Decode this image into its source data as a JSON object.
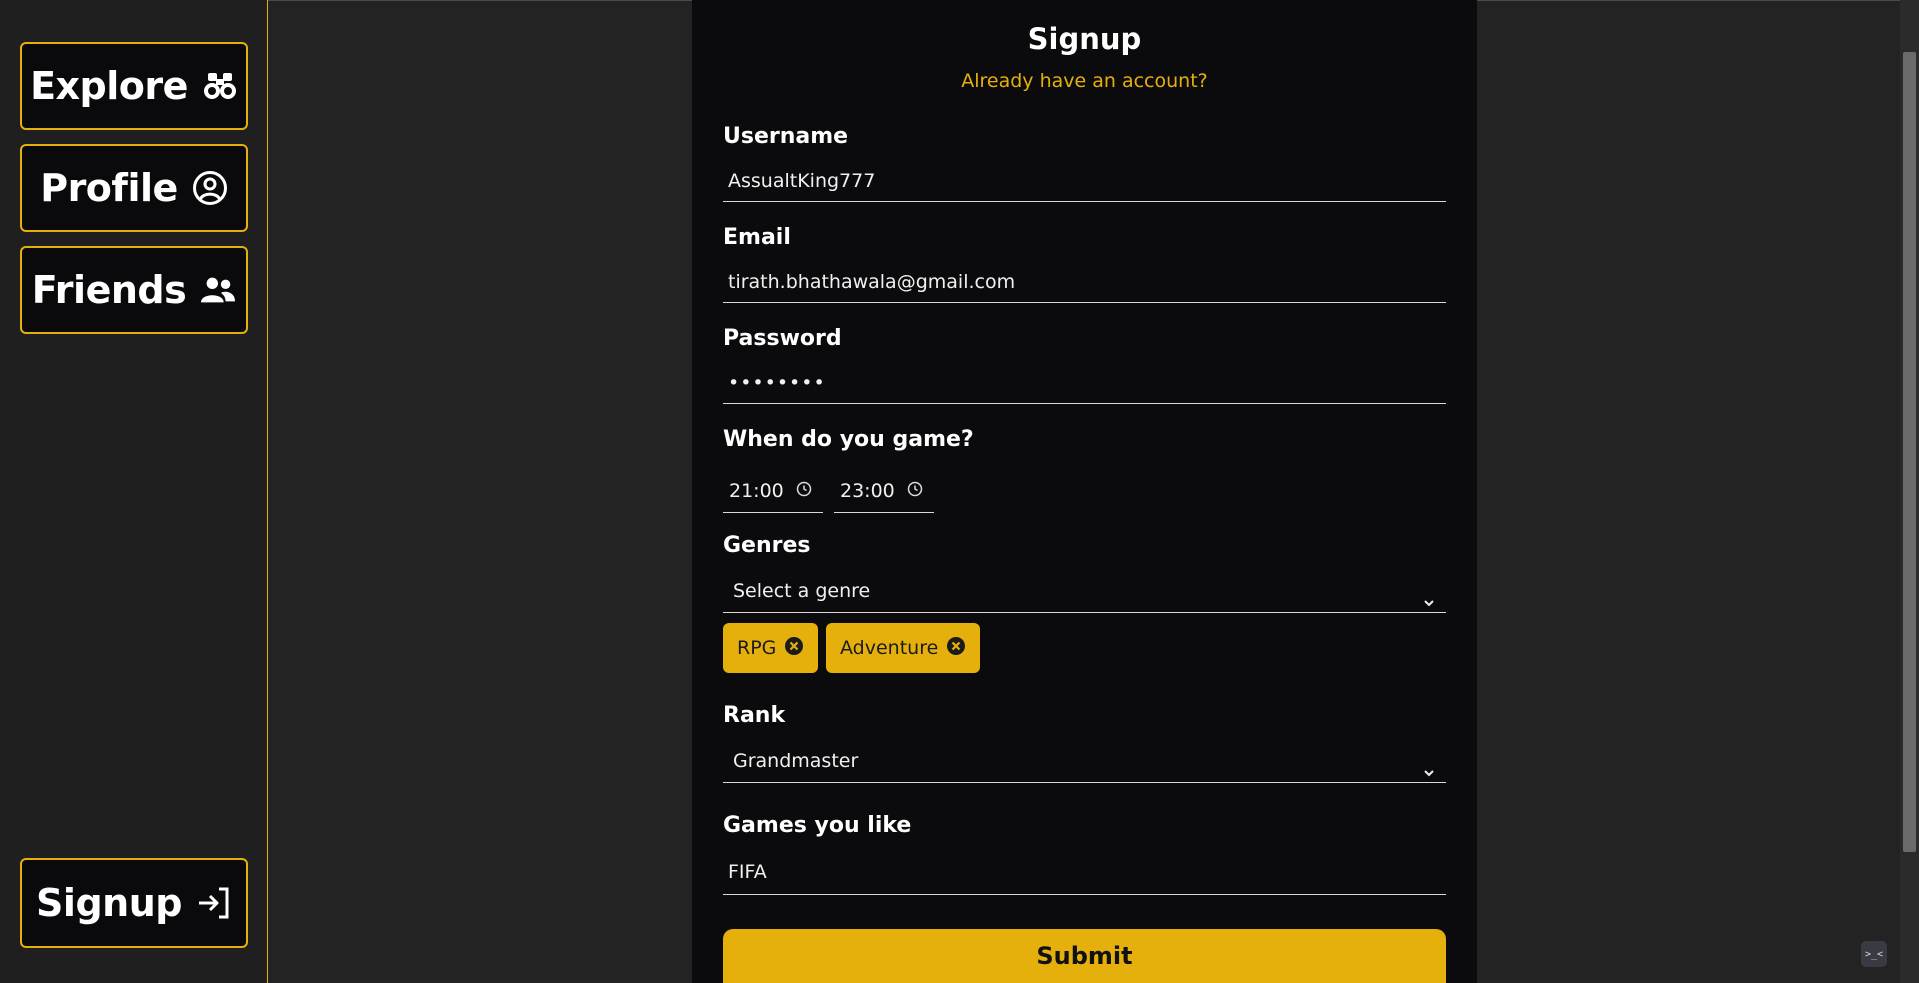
{
  "sidebar": {
    "items": [
      {
        "label": "Explore",
        "icon": "binoculars-icon"
      },
      {
        "label": "Profile",
        "icon": "user-circle-icon"
      },
      {
        "label": "Friends",
        "icon": "users-icon"
      }
    ],
    "signup": {
      "label": "Signup",
      "icon": "sign-in-icon"
    }
  },
  "form": {
    "title": "Signup",
    "subtitle": "Already have an account?",
    "username": {
      "label": "Username",
      "value": "AssualtKing777"
    },
    "email": {
      "label": "Email",
      "value": "tirath.bhathawala@gmail.com"
    },
    "password": {
      "label": "Password",
      "value": "••••••••"
    },
    "schedule": {
      "label": "When do you game?",
      "start": "21:00",
      "end": "23:00"
    },
    "genres": {
      "label": "Genres",
      "placeholder": "Select a genre",
      "selected": [
        "RPG",
        "Adventure"
      ]
    },
    "rank": {
      "label": "Rank",
      "value": "Grandmaster"
    },
    "games": {
      "label": "Games you like",
      "value": "FIFA"
    },
    "submit_label": "Submit"
  },
  "colors": {
    "accent": "#e6b00c",
    "panel": "#0b0b0d",
    "background": "#232323"
  }
}
